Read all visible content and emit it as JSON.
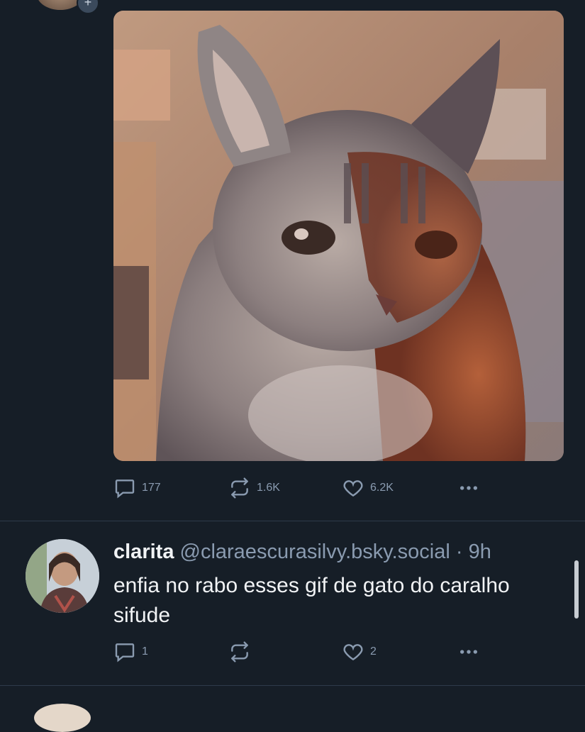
{
  "top_post": {
    "media_alt": "",
    "actions": {
      "replies": "177",
      "reposts": "1.6K",
      "likes": "6.2K"
    }
  },
  "reply_post": {
    "display_name": "clarita",
    "handle": "@claraescurasilvy.bsky.social",
    "time": "· 9h",
    "text": "enfia no rabo esses gif de gato do caralho sifude",
    "actions": {
      "replies": "1",
      "reposts": "",
      "likes": "2"
    }
  },
  "icons": {
    "reply": "speech-bubble-icon",
    "repost": "repost-arrows-icon",
    "like": "heart-icon",
    "more": "ellipsis-icon",
    "follow": "plus-icon"
  },
  "colors": {
    "background": "#161e27",
    "muted_text": "#8a9bb0",
    "divider": "#2e3b4a",
    "primary_text": "#f1f3f5"
  }
}
